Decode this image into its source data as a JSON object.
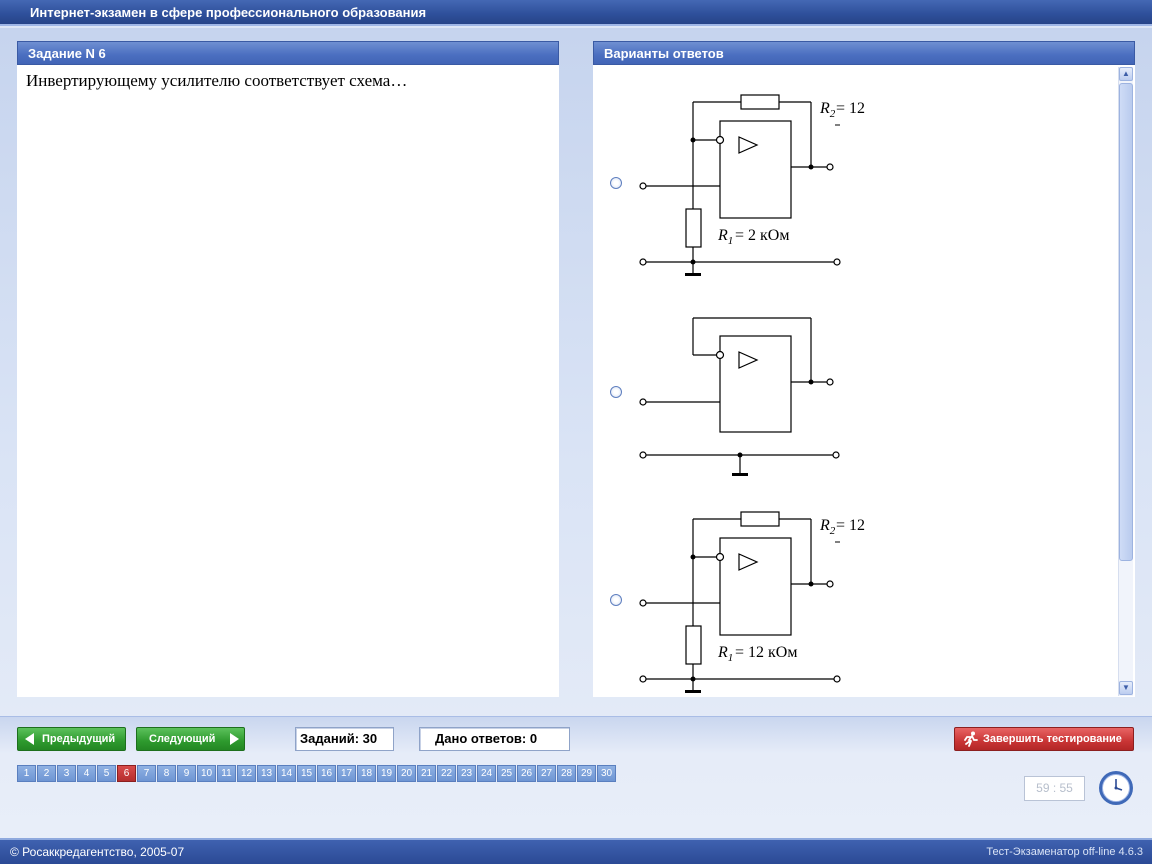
{
  "window": {
    "title": "Интернет-экзамен в сфере профессионального образования"
  },
  "question": {
    "header": "Задание N 6",
    "text": "Инвертирующему усилителю соответствует схема…"
  },
  "answers": {
    "header": "Варианты ответов",
    "options": [
      {
        "r2_label": "= 12",
        "r1_label": "= 2 кОм"
      },
      {},
      {
        "r2_label": "= 12",
        "r1_label": "= 12 кОм"
      }
    ]
  },
  "navigation": {
    "prev_label": "Предыдущий",
    "next_label": "Следующий",
    "tasks_total": "Заданий: 30",
    "answers_given": "Дано ответов: 0",
    "finish_label": "Завершить тестирование",
    "current_page": 6,
    "pages": [
      "1",
      "2",
      "3",
      "4",
      "5",
      "6",
      "7",
      "8",
      "9",
      "10",
      "11",
      "12",
      "13",
      "14",
      "15",
      "16",
      "17",
      "18",
      "19",
      "20",
      "21",
      "22",
      "23",
      "24",
      "25",
      "26",
      "27",
      "28",
      "29",
      "30"
    ]
  },
  "timer": {
    "value": "59 : 55"
  },
  "footer": {
    "copyright": "© Росаккредагентство, 2005-07",
    "version": "Тест-Экзаменатор off-line 4.6.3"
  },
  "colors": {
    "title_bar": "#2e4f9a",
    "panel_header": "#4a6ec0",
    "nav_button": "#2e9a2e",
    "finish_button": "#c93535",
    "active_page": "#b52e2e"
  }
}
